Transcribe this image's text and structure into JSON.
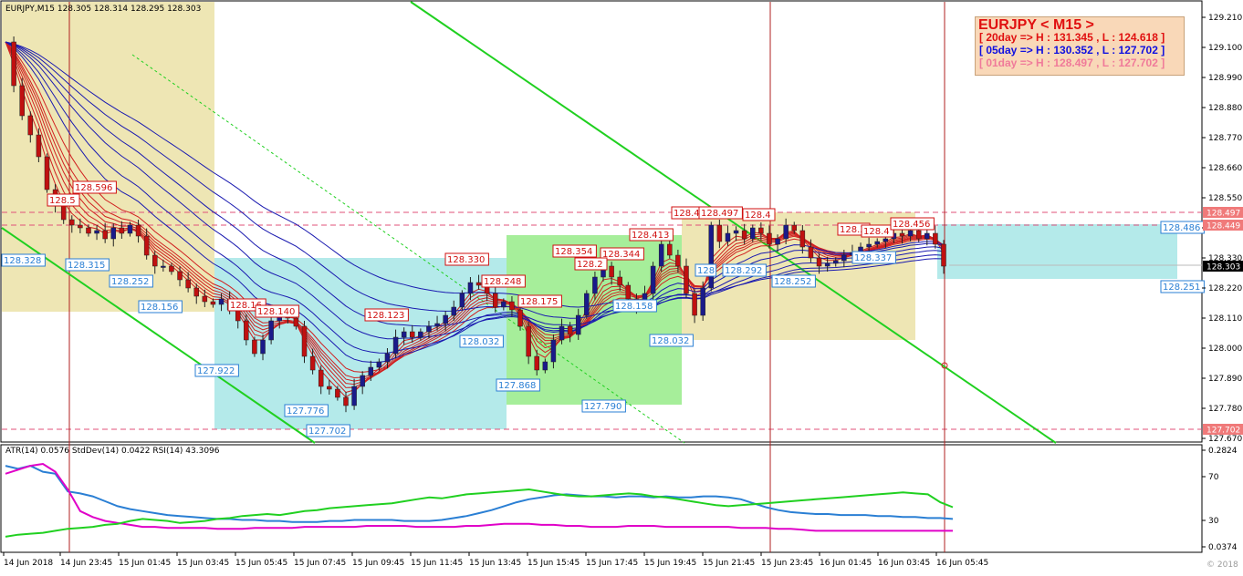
{
  "window": {
    "header": "EURJPY,M15  128.305 128.314 128.295 128.303",
    "indicator_header": "ATR(14) 0.0576  StdDev(14) 0.0422  RSI(14) 43.3096",
    "copyright": "© 2018"
  },
  "info_box": {
    "title": "EURJPY < M15 >",
    "lines": [
      {
        "text": "[ 20day => H : 131.345 , L : 124.618 ]",
        "color": "#e01010"
      },
      {
        "text": "[ 05day => H : 130.352 , L : 127.702 ]",
        "color": "#1010e0"
      },
      {
        "text": "[ 01day => H : 128.497 , L : 127.702 ]",
        "color": "#f07a9a"
      }
    ]
  },
  "chart_data": [
    {
      "type": "candlestick",
      "symbol": "EURJPY",
      "timeframe": "M15",
      "ylim": [
        127.67,
        129.21
      ],
      "y_ticks": [
        "129.210",
        "129.100",
        "128.990",
        "128.880",
        "128.770",
        "128.660",
        "128.550",
        "128.440",
        "128.330",
        "128.220",
        "128.110",
        "128.000",
        "127.890",
        "127.780",
        "127.670"
      ],
      "x_ticks": [
        "14 Jun 2018",
        "14 Jun 23:45",
        "15 Jun 01:45",
        "15 Jun 03:45",
        "15 Jun 05:45",
        "15 Jun 07:45",
        "15 Jun 09:45",
        "15 Jun 11:45",
        "15 Jun 13:45",
        "15 Jun 15:45",
        "15 Jun 17:45",
        "15 Jun 19:45",
        "15 Jun 21:45",
        "15 Jun 23:45",
        "16 Jun 01:45",
        "16 Jun 03:45",
        "16 Jun 05:45"
      ],
      "last_price": "128.303",
      "closes": [
        129.12,
        128.96,
        128.85,
        128.78,
        128.7,
        128.58,
        128.52,
        128.47,
        128.45,
        128.44,
        128.42,
        128.43,
        128.4,
        128.44,
        128.42,
        128.45,
        128.41,
        128.34,
        128.3,
        128.3,
        128.28,
        128.25,
        128.22,
        128.19,
        128.17,
        128.16,
        128.18,
        128.14,
        128.1,
        128.03,
        127.98,
        128.03,
        128.1,
        128.12,
        128.11,
        128.08,
        127.97,
        127.92,
        127.86,
        127.85,
        127.82,
        127.79,
        127.86,
        127.9,
        127.93,
        127.95,
        127.98,
        128.04,
        128.06,
        128.04,
        128.06,
        128.08,
        128.09,
        128.12,
        128.15,
        128.2,
        128.24,
        128.23,
        128.2,
        128.15,
        128.17,
        128.14,
        128.08,
        127.97,
        127.92,
        127.95,
        128.03,
        128.08,
        128.05,
        128.12,
        128.2,
        128.26,
        128.3,
        128.26,
        128.23,
        128.18,
        128.15,
        128.2,
        128.3,
        128.38,
        128.34,
        128.3,
        128.2,
        128.12,
        128.22,
        128.45,
        128.39,
        128.42,
        128.43,
        128.4,
        128.44,
        128.42,
        128.38,
        128.4,
        128.45,
        128.43,
        128.37,
        128.33,
        128.3,
        128.31,
        128.32,
        128.34,
        128.35,
        128.37,
        128.38,
        128.39,
        128.4,
        128.42,
        128.41,
        128.43,
        128.4,
        128.42,
        128.38,
        128.3
      ],
      "band_high": "128.497",
      "band_mid": "128.449",
      "band_low": "127.702",
      "price_labels": [
        {
          "text": "128.596",
          "color": "#d01010"
        },
        {
          "text": "128.5",
          "color": "#d01010"
        },
        {
          "text": "128.328",
          "color": "#2a7fd4"
        },
        {
          "text": "128.315",
          "color": "#2a7fd4"
        },
        {
          "text": "128.252",
          "color": "#2a7fd4"
        },
        {
          "text": "128.156",
          "color": "#2a7fd4"
        },
        {
          "text": "127.922",
          "color": "#2a7fd4"
        },
        {
          "text": "128.16",
          "color": "#d01010"
        },
        {
          "text": "128.140",
          "color": "#d01010"
        },
        {
          "text": "127.776",
          "color": "#2a7fd4"
        },
        {
          "text": "127.702",
          "color": "#2a7fd4"
        },
        {
          "text": "128.123",
          "color": "#d01010"
        },
        {
          "text": "128.330",
          "color": "#d01010"
        },
        {
          "text": "128.248",
          "color": "#d01010"
        },
        {
          "text": "128.032",
          "color": "#2a7fd4"
        },
        {
          "text": "128.175",
          "color": "#d01010"
        },
        {
          "text": "127.868",
          "color": "#2a7fd4"
        },
        {
          "text": "128.354",
          "color": "#d01010"
        },
        {
          "text": "128.344",
          "color": "#d01010"
        },
        {
          "text": "128.2",
          "color": "#d01010"
        },
        {
          "text": "128.413",
          "color": "#d01010"
        },
        {
          "text": "128.158",
          "color": "#2a7fd4"
        },
        {
          "text": "127.790",
          "color": "#2a7fd4"
        },
        {
          "text": "128.032",
          "color": "#2a7fd4"
        },
        {
          "text": "128.4",
          "color": "#d01010"
        },
        {
          "text": "128.497",
          "color": "#d01010"
        },
        {
          "text": "128",
          "color": "#2a7fd4"
        },
        {
          "text": "128.292",
          "color": "#2a7fd4"
        },
        {
          "text": "128.4",
          "color": "#d01010"
        },
        {
          "text": "128.252",
          "color": "#2a7fd4"
        },
        {
          "text": "128.3",
          "color": "#d01010"
        },
        {
          "text": "128.4",
          "color": "#d01010"
        },
        {
          "text": "128.337",
          "color": "#2a7fd4"
        },
        {
          "text": "128.456",
          "color": "#d01010"
        },
        {
          "text": "128.486",
          "color": "#2a7fd4"
        },
        {
          "text": "128.251",
          "color": "#2a7fd4"
        }
      ],
      "right_badges": [
        "128.497",
        "128.449",
        "128.303",
        "127.702"
      ]
    },
    {
      "type": "line",
      "title": "ATR(14) 0.0576  StdDev(14) 0.0422  RSI(14) 43.3096",
      "y_ticks": [
        "0.2824",
        "70",
        "30",
        "0.0374"
      ],
      "series": [
        {
          "name": "ATR(14)",
          "color": "#2a7fd4",
          "values": [
            86,
            83,
            86,
            80,
            78,
            60,
            58,
            55,
            50,
            45,
            42,
            40,
            38,
            36,
            35,
            34,
            33,
            32,
            32,
            31,
            31,
            30,
            30,
            29,
            29,
            29,
            30,
            30,
            31,
            31,
            31,
            31,
            30,
            30,
            30,
            31,
            33,
            35,
            38,
            41,
            45,
            49,
            52,
            54,
            56,
            57,
            56,
            55,
            55,
            54,
            55,
            55,
            54,
            55,
            54,
            54,
            55,
            55,
            54,
            52,
            48,
            44,
            41,
            39,
            38,
            37,
            37,
            36,
            36,
            36,
            35,
            35,
            34,
            34,
            33,
            33,
            32
          ]
        },
        {
          "name": "StdDev(14)",
          "color": "#e000c8",
          "values": [
            78,
            82,
            86,
            88,
            80,
            62,
            40,
            34,
            30,
            28,
            26,
            24,
            24,
            23,
            23,
            23,
            23,
            22,
            22,
            22,
            23,
            23,
            23,
            23,
            24,
            24,
            24,
            24,
            24,
            25,
            25,
            25,
            25,
            24,
            24,
            24,
            24,
            25,
            25,
            26,
            27,
            27,
            27,
            26,
            26,
            25,
            25,
            24,
            24,
            24,
            25,
            25,
            25,
            24,
            24,
            24,
            24,
            24,
            24,
            23,
            23,
            23,
            22,
            22,
            21,
            20,
            20,
            20,
            20,
            20,
            20,
            20,
            20,
            20,
            20,
            20,
            20
          ]
        },
        {
          "name": "RSI(14)",
          "color": "#20d020",
          "values": [
            14,
            16,
            17,
            18,
            20,
            22,
            23,
            24,
            26,
            27,
            30,
            32,
            31,
            30,
            28,
            29,
            30,
            32,
            33,
            35,
            36,
            37,
            36,
            38,
            40,
            41,
            43,
            44,
            45,
            46,
            47,
            48,
            50,
            52,
            54,
            53,
            55,
            57,
            58,
            59,
            60,
            61,
            62,
            60,
            58,
            56,
            55,
            55,
            56,
            57,
            58,
            57,
            55,
            54,
            52,
            50,
            48,
            46,
            45,
            46,
            47,
            48,
            49,
            50,
            51,
            52,
            53,
            54,
            55,
            56,
            57,
            58,
            59,
            58,
            57,
            49,
            44
          ]
        }
      ]
    }
  ]
}
